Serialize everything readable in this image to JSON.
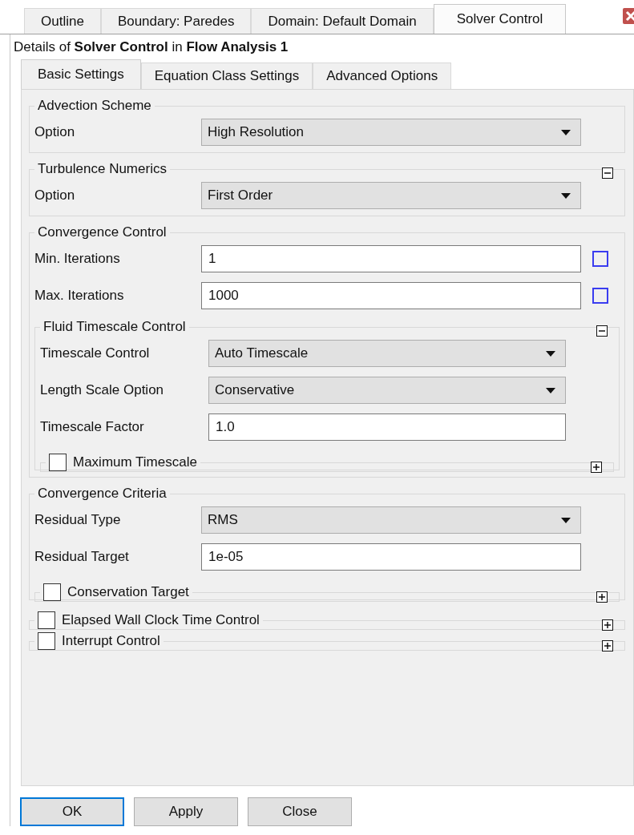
{
  "tabs": [
    {
      "label": "Outline",
      "selected": false
    },
    {
      "label": "Boundary: Paredes",
      "selected": false
    },
    {
      "label": "Domain: Default Domain",
      "selected": false
    },
    {
      "label": "Solver Control",
      "selected": true
    }
  ],
  "details": "Details of **Solver Control** in **Flow Analysis 1**",
  "subtabs": [
    {
      "label": "Basic Settings",
      "selected": true
    },
    {
      "label": "Equation Class Settings",
      "selected": false
    },
    {
      "label": "Advanced Options",
      "selected": false
    }
  ],
  "sections": [
    {
      "title": "Advection Scheme",
      "items": [
        {
          "kind": "dropdown",
          "label": "Option",
          "value": "High Resolution"
        }
      ]
    },
    {
      "title": "Turbulence Numerics",
      "expanded": true,
      "items": [
        {
          "kind": "dropdown",
          "label": "Option",
          "value": "First Order"
        }
      ]
    },
    {
      "title": "Convergence Control",
      "items": [
        {
          "kind": "input",
          "label": "Min. Iterations",
          "value": "1",
          "checked": false
        },
        {
          "kind": "input",
          "label": "Max. Iterations",
          "value": "1000",
          "checked": false
        },
        {
          "kind": "section",
          "title": "Fluid Timescale Control",
          "expanded": true,
          "items": [
            {
              "kind": "dropdown",
              "label": "Timescale Control",
              "value": "Auto Timescale"
            },
            {
              "kind": "dropdown",
              "label": "Length Scale Option",
              "value": "Conservative"
            },
            {
              "kind": "input",
              "label": "Timescale Factor",
              "value": "1.0"
            },
            {
              "kind": "section",
              "title": "Maximum Timescale",
              "checked": false,
              "expanded": false
            }
          ]
        }
      ]
    },
    {
      "title": "Convergence Criteria",
      "items": [
        {
          "kind": "dropdown",
          "label": "Residual Type",
          "value": "RMS"
        },
        {
          "kind": "input",
          "label": "Residual Target",
          "value": "1e-05"
        },
        {
          "kind": "section",
          "title": "Conservation Target",
          "checked": false,
          "expanded": false
        }
      ]
    },
    {
      "title": "Elapsed Wall Clock Time Control",
      "checked": false,
      "expanded": false
    },
    {
      "title": "Interrupt Control",
      "checked": false,
      "expanded": false
    }
  ],
  "buttons": [
    {
      "label": "OK",
      "default": true
    },
    {
      "label": "Apply",
      "default": false
    },
    {
      "label": "Close",
      "default": false
    }
  ]
}
